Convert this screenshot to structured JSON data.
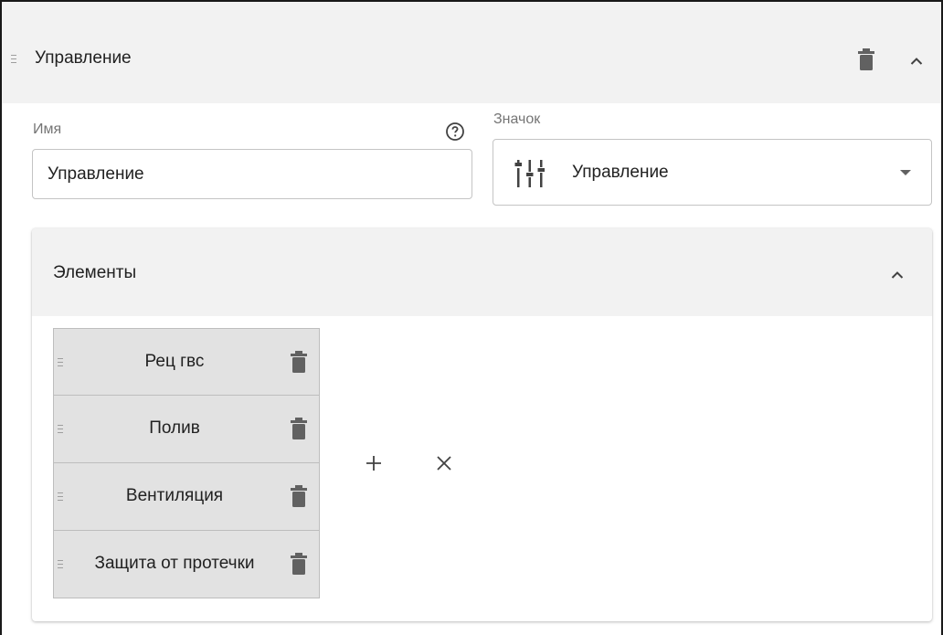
{
  "section": {
    "title": "Управление"
  },
  "form": {
    "name_label": "Имя",
    "name_value": "Управление",
    "icon_label": "Значок",
    "icon_value": "Управление"
  },
  "elements": {
    "title": "Элементы",
    "items": [
      {
        "label": "Рец гвс"
      },
      {
        "label": "Полив"
      },
      {
        "label": "Вентиляция"
      },
      {
        "label": "Защита от протечки"
      }
    ]
  },
  "icons": {
    "drag": "drag-handle-icon",
    "delete": "trash-icon",
    "collapse": "chevron-up-icon",
    "help": "help-circle-icon",
    "icon_preview": "sliders-icon",
    "dropdown": "caret-down-icon",
    "add": "plus-icon",
    "cancel": "close-icon"
  },
  "colors": {
    "panel_header": "#f2f2f2",
    "item_background": "#e2e2e2",
    "icon": "#616161"
  }
}
